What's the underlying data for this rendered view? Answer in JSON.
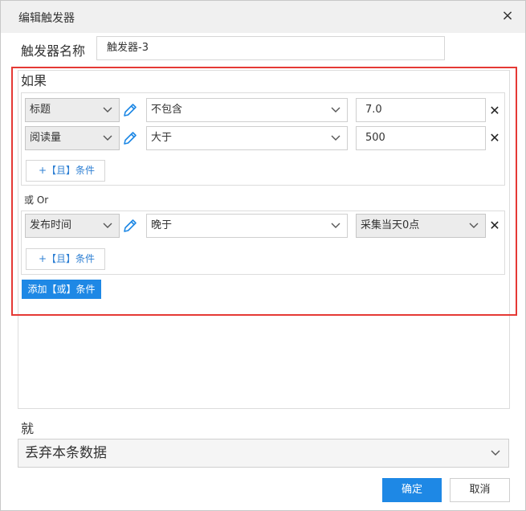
{
  "dialog": {
    "title": "编辑触发器",
    "close_icon": "×"
  },
  "trigger_name": {
    "label": "触发器名称",
    "value": "触发器-3"
  },
  "if_section": {
    "label": "如果",
    "groups": [
      {
        "conditions": [
          {
            "field": "标题",
            "operator": "不包含",
            "value": "7.0",
            "delete_icon": "✕"
          },
          {
            "field": "阅读量",
            "operator": "大于",
            "value": "500",
            "delete_icon": "✕"
          }
        ],
        "add_and_label": "+【且】条件"
      },
      {
        "conditions": [
          {
            "field": "发布时间",
            "operator": "晚于",
            "value": "采集当天0点",
            "delete_icon": "✕"
          }
        ],
        "add_and_label": "+【且】条件"
      }
    ],
    "or_separator": "或 Or",
    "add_or_label": "添加【或】条件"
  },
  "then_section": {
    "label": "就",
    "action": "丢弃本条数据"
  },
  "footer": {
    "ok_label": "确定",
    "cancel_label": "取消"
  },
  "colors": {
    "accent": "#1e88e5",
    "link": "#2d7fd3",
    "highlight_border": "#e53935",
    "titlebar_bg": "#f0f0f0"
  }
}
